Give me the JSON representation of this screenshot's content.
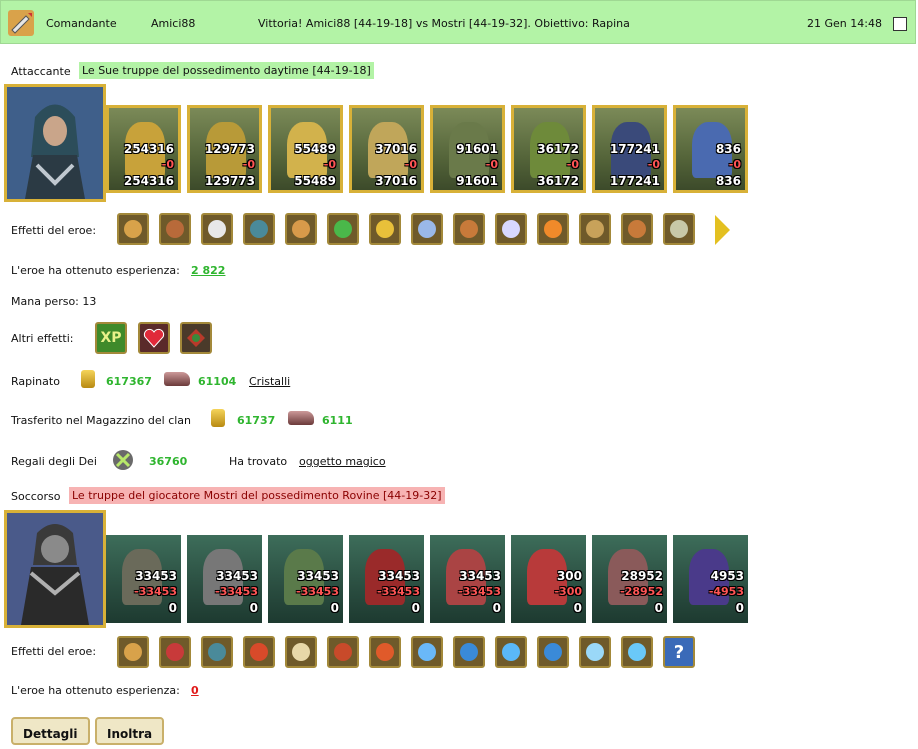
{
  "header": {
    "sender": "Comandante",
    "player": "Amici88",
    "title": "Vittoria! Amici88 [44-19-18] vs Mostri [44-19-32]. Obiettivo: Rapina",
    "date": "21 Gen 14:48"
  },
  "attacker": {
    "label": "Attaccante",
    "name": "Le Sue truppe del possedimento daytime [44-19-18]",
    "units": [
      {
        "top": "254316",
        "lost": "-0",
        "bottom": "254316"
      },
      {
        "top": "129773",
        "lost": "-0",
        "bottom": "129773"
      },
      {
        "top": "55489",
        "lost": "-0",
        "bottom": "55489"
      },
      {
        "top": "37016",
        "lost": "-0",
        "bottom": "37016"
      },
      {
        "top": "91601",
        "lost": "-0",
        "bottom": "91601"
      },
      {
        "top": "36172",
        "lost": "-0",
        "bottom": "36172"
      },
      {
        "top": "177241",
        "lost": "-0",
        "bottom": "177241"
      },
      {
        "top": "836",
        "lost": "-0",
        "bottom": "836"
      }
    ],
    "effects_label": "Effetti del eroe:",
    "exp_label": "L'eroe ha ottenuto esperienza:",
    "exp_value": "2 822",
    "mana": "Mana perso: 13"
  },
  "other_effects": {
    "label": "Altri effetti:",
    "xp": "XP"
  },
  "loot": {
    "label": "Rapinato",
    "gold": "617367",
    "crystals": "61104",
    "crystals_link": "Cristalli"
  },
  "clan": {
    "label": "Trasferito nel Magazzino del clan",
    "gold": "61737",
    "crystals": "6111"
  },
  "gods": {
    "label": "Regali degli Dei",
    "value": "36760",
    "found_label": "Ha trovato",
    "found_link": "oggetto magico"
  },
  "defender": {
    "label": "Soccorso",
    "name": "Le truppe del giocatore Mostri del possedimento Rovine [44-19-32]",
    "units": [
      {
        "top": "33453",
        "lost": "-33453",
        "bottom": "0"
      },
      {
        "top": "33453",
        "lost": "-33453",
        "bottom": "0"
      },
      {
        "top": "33453",
        "lost": "-33453",
        "bottom": "0"
      },
      {
        "top": "33453",
        "lost": "-33453",
        "bottom": "0"
      },
      {
        "top": "33453",
        "lost": "-33453",
        "bottom": "0"
      },
      {
        "top": "300",
        "lost": "-300",
        "bottom": "0"
      },
      {
        "top": "28952",
        "lost": "-28952",
        "bottom": "0"
      },
      {
        "top": "4953",
        "lost": "-4953",
        "bottom": "0"
      }
    ],
    "effects_label": "Effetti del eroe:",
    "exp_label": "L'eroe ha ottenuto esperienza:",
    "exp_value": "0",
    "last_effect": "?"
  },
  "buttons": {
    "details": "Dettagli",
    "forward": "Inoltra"
  }
}
